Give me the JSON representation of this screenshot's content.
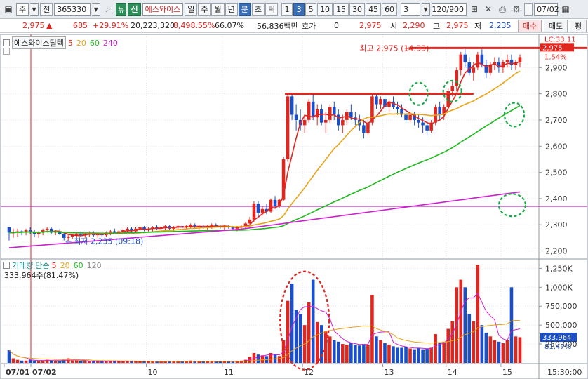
{
  "toolbar": {
    "market": "주",
    "prev_label": "전",
    "code": "365330",
    "news_badge": "뉴",
    "credit_badge": "신",
    "stock_name": "에스와이스",
    "periods": [
      "일",
      "주",
      "월",
      "년",
      "분",
      "초",
      "틱"
    ],
    "active_period": "분",
    "intervals": [
      "1",
      "3",
      "5",
      "10",
      "15",
      "30",
      "45",
      "60"
    ],
    "active_interval": "3",
    "custom_interval": "3",
    "count": "120/900",
    "date": "07/02",
    "icons": [
      "chart-type-icon",
      "search-icon",
      "settings-icon",
      "compare-icon",
      "crosshair-icon",
      "fit-icon",
      "print-icon",
      "gear-icon"
    ]
  },
  "quote": {
    "price": "2,975",
    "change": "685",
    "change_rate": "+29.91%",
    "volume": "20,223,320",
    "volume_rate": "8,498.55%",
    "turnover_rate": "66.07%",
    "amount": "56,836백만",
    "hoga_label": "호가",
    "hoga_value": "0",
    "hoga_price": "2,975",
    "open_label": "시",
    "open": "2,290",
    "high_label": "고",
    "high": "2,975",
    "low_label": "저",
    "low": "2,235",
    "buy_tab": "매수",
    "sell_tab": "매도",
    "eval_tab": "평"
  },
  "price_panel": {
    "legend_name": "에스와이스틸텍",
    "ma_labels": [
      {
        "label": "5",
        "color": "#e0261f"
      },
      {
        "label": "20",
        "color": "#e8a317"
      },
      {
        "label": "60",
        "color": "#1fb81f"
      },
      {
        "label": "240",
        "color": "#d01fd0"
      }
    ],
    "high_note": "최고 2,975 (14:33)",
    "low_note": "최저 2,235 (09:18)",
    "lc_label": "LC:33.11",
    "last_price_tag": "2,975",
    "last_rate_tag": "1.54%",
    "y_ticks": [
      "2,900",
      "2,800",
      "2,700",
      "2,600",
      "2,500",
      "2,400",
      "2,300",
      "2,200"
    ]
  },
  "volume_panel": {
    "legend_name": "거래량",
    "ma_type": "단순",
    "ma_labels": [
      {
        "label": "5",
        "color": "#e0261f"
      },
      {
        "label": "20",
        "color": "#e8a317"
      },
      {
        "label": "60",
        "color": "#1fb81f"
      },
      {
        "label": "120",
        "color": "#888888"
      }
    ],
    "current": "333,964주(81.47%)",
    "y_ticks": [
      "1,250K",
      "1,000K",
      "750,000",
      "500,000",
      "250,000"
    ],
    "last_vol_tag": "333,964",
    "last_vol_rate": "81.47%"
  },
  "x_axis": {
    "labels": [
      "07/01",
      "07/02",
      "10",
      "11",
      "12",
      "13",
      "14",
      "15"
    ],
    "time_readout": "15:30:00"
  },
  "chart_data": {
    "type": "candlestick",
    "interval": "3min",
    "price_ylim": [
      2180,
      3000
    ],
    "volume_ylim": [
      0,
      1300000
    ],
    "candles": [
      [
        2290,
        2290,
        2240,
        2270,
        170000
      ],
      [
        2270,
        2285,
        2250,
        2270,
        60000
      ],
      [
        2270,
        2285,
        2255,
        2275,
        40000
      ],
      [
        2275,
        2280,
        2260,
        2270,
        30000
      ],
      [
        2270,
        2285,
        2260,
        2280,
        30000
      ],
      [
        2280,
        2290,
        2265,
        2270,
        40000
      ],
      [
        2270,
        2280,
        2255,
        2265,
        30000
      ],
      [
        2265,
        2275,
        2250,
        2270,
        30000
      ],
      [
        2270,
        2285,
        2260,
        2280,
        30000
      ],
      [
        2280,
        2290,
        2270,
        2285,
        40000
      ],
      [
        2285,
        2290,
        2265,
        2270,
        30000
      ],
      [
        2270,
        2280,
        2260,
        2275,
        20000
      ],
      [
        2275,
        2285,
        2260,
        2265,
        30000
      ],
      [
        2265,
        2270,
        2240,
        2250,
        40000
      ],
      [
        2250,
        2260,
        2235,
        2255,
        60000
      ],
      [
        2255,
        2265,
        2245,
        2260,
        30000
      ],
      [
        2260,
        2270,
        2250,
        2265,
        30000
      ],
      [
        2265,
        2275,
        2255,
        2260,
        20000
      ],
      [
        2260,
        2270,
        2250,
        2265,
        20000
      ],
      [
        2265,
        2275,
        2255,
        2270,
        20000
      ],
      [
        2270,
        2275,
        2255,
        2260,
        20000
      ],
      [
        2260,
        2270,
        2250,
        2265,
        20000
      ],
      [
        2265,
        2270,
        2255,
        2260,
        20000
      ],
      [
        2260,
        2275,
        2255,
        2270,
        20000
      ],
      [
        2270,
        2280,
        2260,
        2275,
        20000
      ],
      [
        2275,
        2285,
        2265,
        2270,
        20000
      ],
      [
        2270,
        2280,
        2260,
        2275,
        20000
      ],
      [
        2275,
        2285,
        2265,
        2280,
        20000
      ],
      [
        2280,
        2290,
        2270,
        2285,
        20000
      ],
      [
        2285,
        2290,
        2270,
        2275,
        20000
      ],
      [
        2275,
        2290,
        2270,
        2285,
        20000
      ],
      [
        2285,
        2295,
        2275,
        2290,
        20000
      ],
      [
        2290,
        2295,
        2275,
        2280,
        20000
      ],
      [
        2280,
        2290,
        2270,
        2285,
        20000
      ],
      [
        2285,
        2295,
        2275,
        2290,
        20000
      ],
      [
        2290,
        2300,
        2280,
        2285,
        20000
      ],
      [
        2285,
        2295,
        2275,
        2290,
        20000
      ],
      [
        2290,
        2300,
        2280,
        2295,
        20000
      ],
      [
        2295,
        2300,
        2280,
        2285,
        20000
      ],
      [
        2285,
        2295,
        2275,
        2290,
        20000
      ],
      [
        2290,
        2300,
        2280,
        2295,
        20000
      ],
      [
        2295,
        2300,
        2285,
        2290,
        20000
      ],
      [
        2290,
        2300,
        2280,
        2295,
        20000
      ],
      [
        2295,
        2305,
        2285,
        2300,
        30000
      ],
      [
        2300,
        2305,
        2285,
        2290,
        20000
      ],
      [
        2290,
        2300,
        2280,
        2295,
        20000
      ],
      [
        2295,
        2300,
        2285,
        2290,
        20000
      ],
      [
        2290,
        2300,
        2280,
        2295,
        20000
      ],
      [
        2295,
        2305,
        2285,
        2300,
        20000
      ],
      [
        2300,
        2305,
        2290,
        2295,
        20000
      ],
      [
        2295,
        2300,
        2285,
        2290,
        20000
      ],
      [
        2290,
        2300,
        2280,
        2295,
        20000
      ],
      [
        2295,
        2300,
        2285,
        2290,
        20000
      ],
      [
        2290,
        2295,
        2280,
        2285,
        20000
      ],
      [
        2285,
        2295,
        2275,
        2290,
        20000
      ],
      [
        2290,
        2300,
        2280,
        2295,
        30000
      ],
      [
        2295,
        2310,
        2285,
        2305,
        40000
      ],
      [
        2305,
        2330,
        2300,
        2320,
        80000
      ],
      [
        2320,
        2390,
        2310,
        2380,
        130000
      ],
      [
        2380,
        2390,
        2330,
        2345,
        110000
      ],
      [
        2345,
        2370,
        2335,
        2360,
        100000
      ],
      [
        2360,
        2380,
        2340,
        2350,
        90000
      ],
      [
        2350,
        2400,
        2345,
        2395,
        130000
      ],
      [
        2395,
        2410,
        2360,
        2370,
        120000
      ],
      [
        2370,
        2400,
        2365,
        2395,
        90000
      ],
      [
        2395,
        2560,
        2390,
        2550,
        300000
      ],
      [
        2550,
        2800,
        2540,
        2790,
        820000
      ],
      [
        2790,
        2800,
        2700,
        2720,
        1050000
      ],
      [
        2720,
        2760,
        2660,
        2700,
        700000
      ],
      [
        2700,
        2740,
        2660,
        2680,
        650000
      ],
      [
        2680,
        2720,
        2650,
        2700,
        500000
      ],
      [
        2700,
        2780,
        2690,
        2770,
        800000
      ],
      [
        2770,
        2800,
        2700,
        2710,
        1100000
      ],
      [
        2710,
        2760,
        2680,
        2740,
        540000
      ],
      [
        2740,
        2760,
        2680,
        2690,
        500000
      ],
      [
        2690,
        2730,
        2650,
        2700,
        420000
      ],
      [
        2700,
        2760,
        2690,
        2750,
        350000
      ],
      [
        2750,
        2770,
        2700,
        2720,
        300000
      ],
      [
        2720,
        2740,
        2660,
        2680,
        280000
      ],
      [
        2680,
        2720,
        2650,
        2700,
        250000
      ],
      [
        2700,
        2740,
        2680,
        2730,
        240000
      ],
      [
        2730,
        2760,
        2700,
        2710,
        260000
      ],
      [
        2710,
        2730,
        2680,
        2700,
        240000
      ],
      [
        2700,
        2720,
        2660,
        2680,
        230000
      ],
      [
        2680,
        2700,
        2630,
        2650,
        250000
      ],
      [
        2650,
        2700,
        2640,
        2690,
        240000
      ],
      [
        2690,
        2800,
        2680,
        2790,
        900000
      ],
      [
        2790,
        2800,
        2740,
        2760,
        350000
      ],
      [
        2760,
        2790,
        2740,
        2780,
        300000
      ],
      [
        2780,
        2790,
        2740,
        2750,
        260000
      ],
      [
        2750,
        2780,
        2730,
        2770,
        240000
      ],
      [
        2770,
        2790,
        2740,
        2750,
        220000
      ],
      [
        2750,
        2770,
        2720,
        2740,
        200000
      ],
      [
        2740,
        2760,
        2710,
        2720,
        200000
      ],
      [
        2720,
        2740,
        2690,
        2700,
        210000
      ],
      [
        2700,
        2730,
        2690,
        2720,
        190000
      ],
      [
        2720,
        2730,
        2680,
        2700,
        180000
      ],
      [
        2700,
        2720,
        2670,
        2690,
        200000
      ],
      [
        2690,
        2710,
        2650,
        2680,
        180000
      ],
      [
        2680,
        2700,
        2640,
        2660,
        190000
      ],
      [
        2660,
        2700,
        2650,
        2690,
        200000
      ],
      [
        2690,
        2760,
        2680,
        2750,
        380000
      ],
      [
        2750,
        2770,
        2700,
        2720,
        260000
      ],
      [
        2720,
        2760,
        2700,
        2750,
        280000
      ],
      [
        2750,
        2820,
        2740,
        2810,
        450000
      ],
      [
        2810,
        2850,
        2790,
        2830,
        550000
      ],
      [
        2830,
        2900,
        2810,
        2890,
        1000000
      ],
      [
        2890,
        2960,
        2870,
        2950,
        1100000
      ],
      [
        2950,
        2975,
        2900,
        2920,
        1000000
      ],
      [
        2920,
        2940,
        2870,
        2880,
        650000
      ],
      [
        2880,
        2920,
        2850,
        2900,
        550000
      ],
      [
        2900,
        2960,
        2890,
        2950,
        1300000
      ],
      [
        2950,
        2970,
        2900,
        2910,
        500000
      ],
      [
        2910,
        2930,
        2860,
        2880,
        400000
      ],
      [
        2880,
        2920,
        2870,
        2910,
        350000
      ],
      [
        2910,
        2940,
        2890,
        2920,
        300000
      ],
      [
        2920,
        2940,
        2880,
        2900,
        280000
      ],
      [
        2900,
        2930,
        2880,
        2920,
        260000
      ],
      [
        2920,
        2950,
        2900,
        2930,
        300000
      ],
      [
        2930,
        2950,
        2890,
        2910,
        1000000
      ],
      [
        2910,
        2930,
        2890,
        2920,
        350000
      ],
      [
        2920,
        2950,
        2900,
        2940,
        340000
      ]
    ],
    "ma_series": [
      {
        "name": "5",
        "color": "#e0261f"
      },
      {
        "name": "20",
        "color": "#e8a317"
      },
      {
        "name": "60",
        "color": "#1fb81f"
      },
      {
        "name": "240",
        "color": "#d01fd0"
      }
    ],
    "resistance_levels": [
      2975,
      2800
    ],
    "reference_line": 2370
  }
}
